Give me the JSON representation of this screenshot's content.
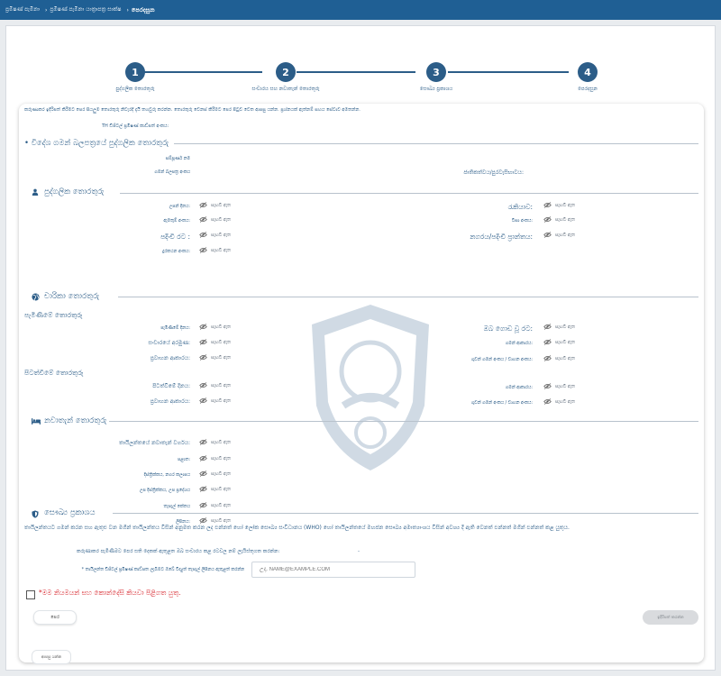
{
  "topbar": {
    "crumb1": "ප්‍රමිෂණ් පැමිනා",
    "crumb2": "ප්‍රමිෂණ් පැමිනා යාත්‍රාපත්‍ර සාක්ෂ",
    "current": "පෙරදසුන"
  },
  "stepper": {
    "steps": [
      {
        "number": "1",
        "label": "පුද්ගලික තොරතුරු"
      },
      {
        "number": "2",
        "label": "සංචාරය සහ නවාතැන් තොරතුරු"
      },
      {
        "number": "3",
        "label": "සෞඛ්‍ය ප්‍රකාශය"
      },
      {
        "number": "4",
        "label": "පෙරදසුන"
      }
    ]
  },
  "intro": "කරුණාකර ඉදිරිපත් කිරීමට පෙර සියලුම තොරතුරු නිවැරදි දැයි තහවුරු කරන්න. තොරතුරු වෙනස් කිරීමට පෙර පිටුව වෙත ආපසු යන්න. ප්‍රශ්නයක් ඇත්නම් සහය සේවාව අමතන්න.",
  "app_num_label": "TH ඩිජිටල් ප්‍රමිෂණ් කාඩ්පත් අංකය:",
  "sections": {
    "foreign": {
      "title": "විදේශ ගමන් බලපත්‍රයේ පුද්ගලික තොරතුරු",
      "fields": [
        "සම්පූර්ණ නම",
        "ගමන් බලපත්‍ර අංකය",
        "ජාතිකත්වය/පුරවැසිභාවය:"
      ]
    },
    "personal": {
      "title": "පුද්ගලික තොරතුරු",
      "fields": [
        "උපන් දිනය:",
        "රැකියාව:",
        "ඇමතුම් අංකය:",
        "වීසා අංකය:",
        "පදිංචි රට :",
        "නගරය/පදිංචි ප්‍රාන්තය:",
        "දුරකථන අංකය:"
      ]
    },
    "trip": {
      "title": "චාරිකා තොරතුරු",
      "arrival_head": "පැමිණීමේ තොරතුරු",
      "departure_head": "පිටත්වීමේ තොරතුරු",
      "fields": [
        "පැමිණීමේ දිනය:",
        "ඔබ ගොඩ වූ රට:",
        "සංචාරයේ අරමුණ:",
        "ගමන් ආකාරය:",
        "ප්‍රවාහන ආකාරය:",
        "ගුවන් ගමන් අංකය / වාහන අංකය:",
        "පිටත්වීමේ දිනය:",
        "ගමන් ආකාරය:",
        "ප්‍රවාහන ආකාරය:",
        "ගුවන් ගමන් අංකය / වාහන අංකය:"
      ]
    },
    "stay": {
      "title": "නවාතැන් තොරතුරු",
      "fields": [
        "තායිලන්තයේ නවාතැන් වර්ගය:",
        "පළාත:",
        "දිස්ත්‍රික්කය, නගර කලාපය",
        "උප දිස්ත්‍රික්කය, උප ප්‍රදේශය",
        "තැපැල් කේතය",
        "ලිපිනය:"
      ]
    },
    "health": {
      "title": "සෞඛ්‍ය ප්‍රකාශය",
      "text": "තායිලන්තයට ගමන් කරන සහ ඇතුළු වන මගීන් තායිලන්තය විසින් අනුමත කරන ලද එන්නත් හෝ ලෝක සෞඛ්‍ය සංවිධානය (WHO) හෝ තායිලන්තයේ මහජන සෞඛ්‍ය අමාත්‍යාංශය විසින් අවශ්‍ය දී ඇති වෙනත් එන්නත් මගින් එන්නත් කළ යුතුය.",
      "question": "කරුණාකර පැමිණීමට පෙර සති දෙකක් ඇතුළත ඔබ සංචාරය කළ රටවල නම් ලැයිස්තුගත කරන්න:",
      "question_value": "-"
    }
  },
  "empty_value": "සැඟවී ඇත",
  "email": {
    "label": "* තායිලන්ත ඩිජිටල් ප්‍රමිෂණ් කාඩ්පත ලැබීමට ඔබේ විද්‍යුත් තැපැල් ලිපිනය ඇතුළත් කරන්න",
    "placeholder": "උදා. NAME@EXAMPLE.COM"
  },
  "agree": "*මම නියමයන් සහ කොන්දේසි කියවා පිළිගත යුතු.",
  "buttons": {
    "back": "පෙර",
    "submit": "ඉදිරිපත් කරන්න",
    "bottom": "ආපසු යන්න"
  },
  "colors": {
    "primary": "#2c5d88",
    "topbar": "#1f5f94",
    "required": "#d61f26"
  }
}
